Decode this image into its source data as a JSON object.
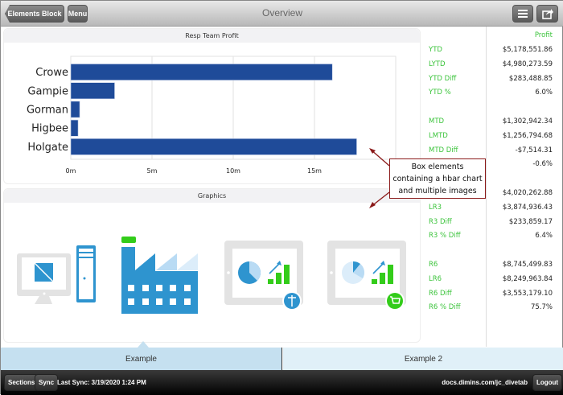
{
  "header": {
    "back_label": "Elements Block",
    "menu_label": "Menu",
    "title": "Overview",
    "list_icon": "list-icon",
    "share_icon": "share-icon"
  },
  "chart_panel": {
    "title": "Resp Team Profit"
  },
  "graphics_panel": {
    "title": "Graphics",
    "images": [
      "computer-image",
      "factory-image",
      "tablet-healthcare-image",
      "tablet-retail-image"
    ]
  },
  "chart_data": {
    "type": "bar",
    "orientation": "horizontal",
    "categories": [
      "Crowe",
      "Gampie",
      "Gorman",
      "Higbee",
      "Holgate"
    ],
    "values": [
      16100000,
      2700000,
      550000,
      450000,
      17600000
    ],
    "xlim": [
      0,
      20000000
    ],
    "ticks": [
      "0m",
      "5m",
      "10m",
      "15m"
    ],
    "tick_values": [
      0,
      5000000,
      10000000,
      15000000
    ],
    "grid": true,
    "color": "#1f4b99"
  },
  "profit": {
    "header": "Profit",
    "groups": [
      [
        {
          "label": "YTD",
          "value": "$5,178,551.86"
        },
        {
          "label": "LYTD",
          "value": "$4,980,273.59"
        },
        {
          "label": "YTD Diff",
          "value": "$283,488.85"
        },
        {
          "label": "YTD %",
          "value": "6.0%"
        }
      ],
      [
        {
          "label": "MTD",
          "value": "$1,302,942.34"
        },
        {
          "label": "LMTD",
          "value": "$1,256,794.68"
        },
        {
          "label": "MTD Diff",
          "value": "-$7,514.31"
        },
        {
          "label": "",
          "value": "-0.6%"
        }
      ],
      [
        {
          "label": "",
          "value": "$4,020,262.88"
        },
        {
          "label": "LR3",
          "value": "$3,874,936.43"
        },
        {
          "label": "R3 Diff",
          "value": "$233,859.17"
        },
        {
          "label": "R3 % Diff",
          "value": "6.4%"
        }
      ],
      [
        {
          "label": "R6",
          "value": "$8,745,499.83"
        },
        {
          "label": "LR6",
          "value": "$8,249,963.84"
        },
        {
          "label": "R6 Diff",
          "value": "$3,553,179.10"
        },
        {
          "label": "R6 % Diff",
          "value": "75.7%"
        }
      ]
    ]
  },
  "callout": {
    "lines": [
      "Box elements",
      "containing a hbar chart",
      "and multiple images"
    ],
    "color": "#8b1a1a"
  },
  "tabs": [
    {
      "label": "Example",
      "active": true
    },
    {
      "label": "Example 2",
      "active": false
    }
  ],
  "footer": {
    "sections_label": "Sections",
    "sync_label": "Sync",
    "last_sync": "Last Sync: 3/19/2020 1:24 PM",
    "url": "docs.dimins.com/jc_divetab",
    "logout_label": "Logout"
  },
  "colors": {
    "label_green": "#3cc43c",
    "icon_blue": "#2e94cf",
    "icon_green": "#33cc1a"
  }
}
